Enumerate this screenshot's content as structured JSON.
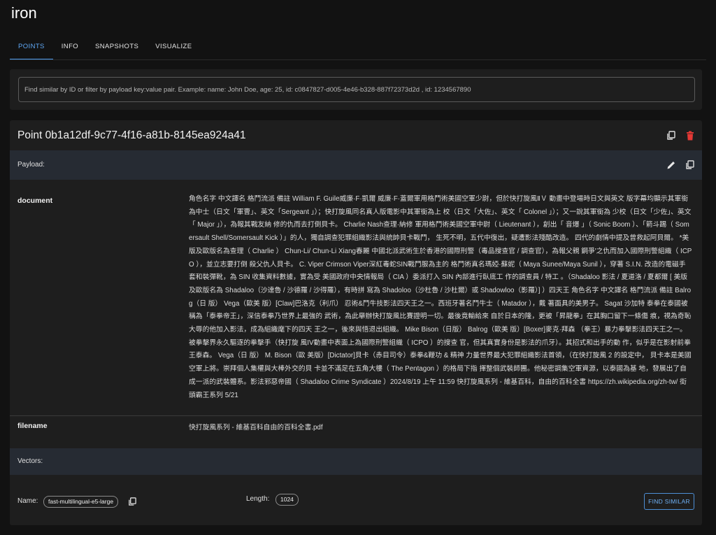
{
  "app": {
    "title": "iron"
  },
  "tabs": [
    {
      "label": "POINTS",
      "active": true
    },
    {
      "label": "INFO",
      "active": false
    },
    {
      "label": "SNAPSHOTS",
      "active": false
    },
    {
      "label": "VISUALIZE",
      "active": false
    }
  ],
  "search": {
    "placeholder": "Find similar by ID or filter by payload key:value pair. Example: name: John Doe, age: 25, id: c0847827-d005-4e46-b328-887f72373d2d , id: 1234567890",
    "value": ""
  },
  "point": {
    "title": "Point 0b1a12df-9c77-4f16-a81b-8145ea924a41",
    "icons": {
      "copy": "copy-icon",
      "delete": "delete-icon",
      "edit": "edit-icon",
      "copy_payload": "copy-icon"
    },
    "payload_label": "Payload:",
    "payload": [
      {
        "key": "document",
        "value": "角色名字 中文譯名 格鬥流派 備註 William F. Guile威廉·F·凱爾 威廉·F·蓋爾軍用格鬥術美國空軍少尉，但於快打旋風ⅡＶ 動畫中登場時日文與英文 版字幕均顯示其軍銜為中士（日文「軍曹」、英文「Sergeant 」）；快打旋風同名真人版電影中其軍銜為上 校（日文「大佐」、英文「 Colonel 」）；又一說其軍銜為 少校（日文「少佐」、英文「 Major 」），為報其戰友納 修的仇而去打倒貝卡。 Charlie Nash查理·納修 軍用格鬥術美國空軍中尉（ Lieutenant ），創出「 音爆 」（ Sonic Boom ）、「箭斗踢（ Somersault Shell/Somersault Kick ）」的人，獨自調查犯罪組織影法與統帥貝卡戰鬥， 生死不明，五代中復出，疑遭影法殘酷改造。 四代的劇情中提及曾救起阿貝爾。 *美版及歐版名為查理（ Charlie ） Chun-Li/ Chun-Li Xiang春麗 中國北派武術生於香港的國際刑警（毒品搜查官 / 調查官），為報父親 鋼爭'之仇而加入國際刑警組織（ ICPO ），並立志要打倒 殺父仇人貝卡。 C. Viper Crimson Viper深紅毒蛇SIN戰鬥服為主的 格鬥術真名瑪婭·蘇妮（ Maya Sunee/Maya Sunil ），穿著 S.I.N. 改造的電磁手套和裝彈靴，為 SIN 收集資料數據，實為受 美國政府中央情報局（ CIA ）委派打入 SIN 內部進行臥底工 作的調查員 / 特工 。（Shadaloo 影法 / 夏道洛 / 夏都爾 [ 美版及歐版名為 Shadaloo（沙達魯 / 沙德羅 / 沙得羅），有時拼 寫為 Shadoloo（沙杜魯 / 沙杜爾）或 Shadowloo（影羅）] ）四天王 角色名字 中文譯名 格鬥流派 備註 Balrog（日 版） Vega（歐美 版）[Claw]巴洛克（利爪） 忍術&鬥牛技影法四天王之一。西班牙著名鬥牛士（ Matador ），戴 著面具的美男子。 Sagat 沙加特 泰拳在泰國被稱為「泰拳帝王」，深信泰拳乃世界上最強的 武術，為此舉辦快打旋風比賽證明一切。最後竟輸給來 自於日本的隆，更被「昇龍拳」在其胸口留下一條傷 痕，視為奇恥大辱的他加入影法，成為組織麾下的四天 王之一，後來與悟退出組織。 Mike Bison（日版） Balrog（歐美 版）[Boxer]麥克·拜森 （拳王）暴力拳擊影法四天王之一。被拳擊界永久驅逐的拳擊手（快打旋 風IV動畫中表面上為國際刑警組織（ ICPO ）的搜查 官，但其真實身份是影法的爪牙）。其招式和出手的動 作，似乎是在影射前拳王泰森。 Vega（日 版） M. Bison（歐 美版）[Dictator]貝卡（赤目司令）泰拳&鞭功 & 精神 力量世界最大犯罪組織影法首領，（在快打旋風 2 的設定中， 貝卡本是美國空軍上將。崇拜個人集權與大棒外交的貝 卡並不滿足在五角大樓（ The Pentagon ）的格局下指 揮整個武裝師團。他秘密調集空軍資源，以泰國為基 地，發展出了自成一派的武裝體系。影法邪惡帝國（ Shadaloo Crime Syndicate ）2024/8/19 上午 11:59 快打旋風系列 - 維基百科，自由的百科全書 https://zh.wikipedia.org/zh-tw/ 街頭霸王系列 5/21"
      },
      {
        "key": "filename",
        "value": "快打旋風系列 - 維基百科自由的百科全書.pdf"
      }
    ],
    "vectors_label": "Vectors:",
    "vector": {
      "name_label": "Name:",
      "name": "fast-multilingual-e5-large",
      "length_label": "Length:",
      "length": "1024",
      "find_similar": "FIND SIMILAR"
    }
  },
  "colors": {
    "accent": "#4d9cf0",
    "danger": "#e53935",
    "background": "#121212",
    "card": "#1e1e1e",
    "section_bar": "#262b33"
  }
}
